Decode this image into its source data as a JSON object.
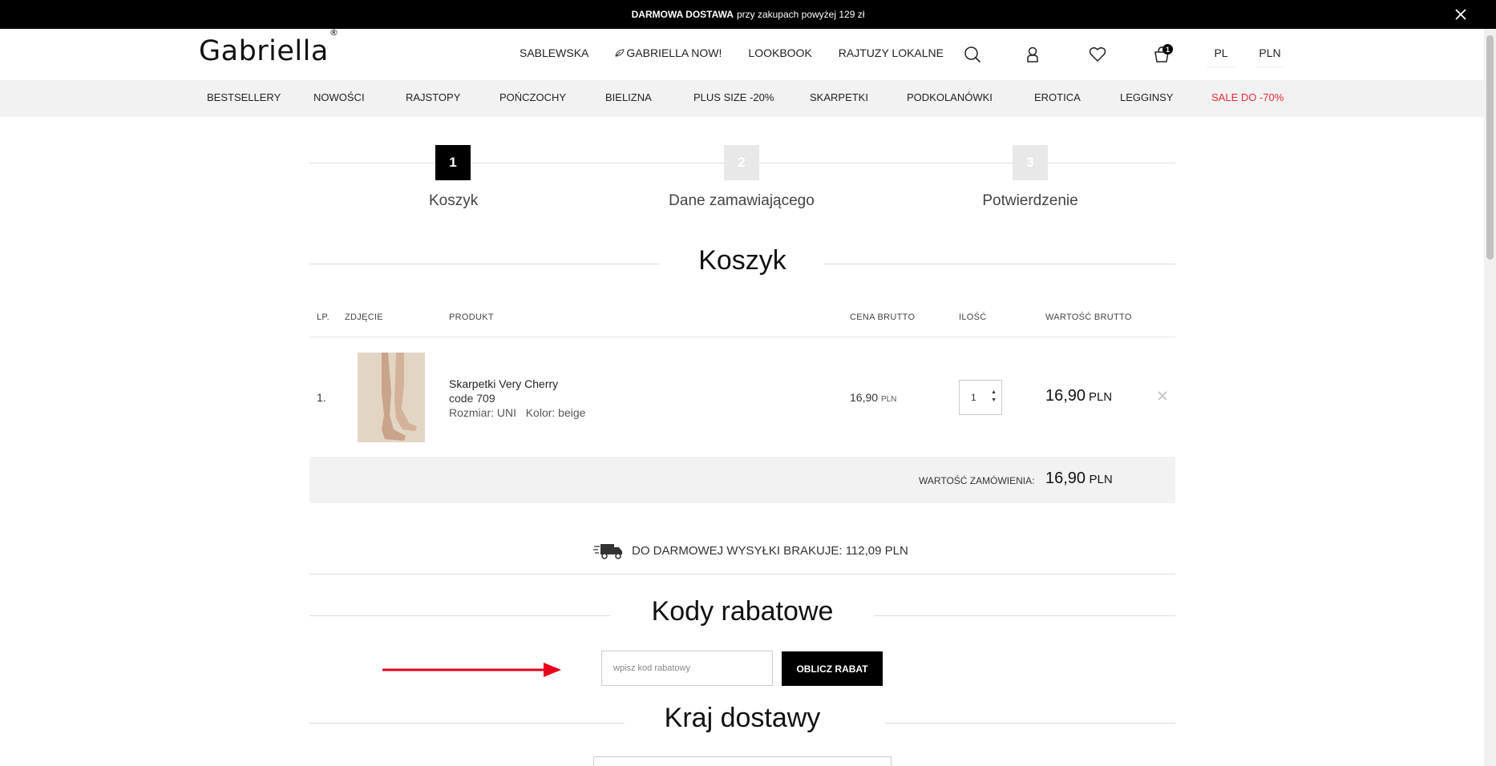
{
  "topbar": {
    "bold": "DARMOWA DOSTAWA",
    "text": "przy zakupach powyżej 129 zł"
  },
  "header": {
    "logo": "Gabriella",
    "logo_mark": "®",
    "nav": [
      "SABLEWSKA",
      "GABRIELLA NOW!",
      "LOOKBOOK",
      "RAJTUZY LOKALNE"
    ],
    "cart_count": "1",
    "language": "PL",
    "currency": "PLN"
  },
  "categories": [
    "BESTSELLERY",
    "NOWOŚCI",
    "RAJSTOPY",
    "POŃCZOCHY",
    "BIELIZNA",
    "PLUS SIZE -20%",
    "SKARPETKI",
    "PODKOLANÓWKI",
    "EROTICA",
    "LEGGINSY",
    "SALE DO -70%"
  ],
  "sale_color": "#e8293b",
  "steps": [
    {
      "num": "1",
      "label": "Koszyk"
    },
    {
      "num": "2",
      "label": "Dane zamawiającego"
    },
    {
      "num": "3",
      "label": "Potwierdzenie"
    }
  ],
  "cart": {
    "title": "Koszyk",
    "columns": {
      "lp": "LP.",
      "photo": "ZDJĘCIE",
      "product": "PRODUKT",
      "price": "CENA BRUTTO",
      "qty": "ILOŚĆ",
      "value": "WARTOŚĆ BRUTTO"
    },
    "items": [
      {
        "lp": "1.",
        "name": "Skarpetki Very Cherry",
        "code": "code 709",
        "size_label": "Rozmiar:",
        "size": "UNI",
        "color_label": "Kolor:",
        "color": "beige",
        "price": "16,90",
        "price_unit": "PLN",
        "qty": "1",
        "value": "16,90",
        "value_unit": "PLN"
      }
    ],
    "summary_label": "WARTOŚĆ ZAMÓWIENIA:",
    "summary_value": "16,90",
    "summary_unit": "PLN"
  },
  "shipping_text": "DO DARMOWEJ WYSYŁKI BRAKUJE: 112,09 PLN",
  "promo": {
    "title": "Kody rabatowe",
    "placeholder": "wpisz kod rabatowy",
    "button": "OBLICZ RABAT"
  },
  "country": {
    "title": "Kraj dostawy"
  },
  "arrow_color": "#e8001c"
}
